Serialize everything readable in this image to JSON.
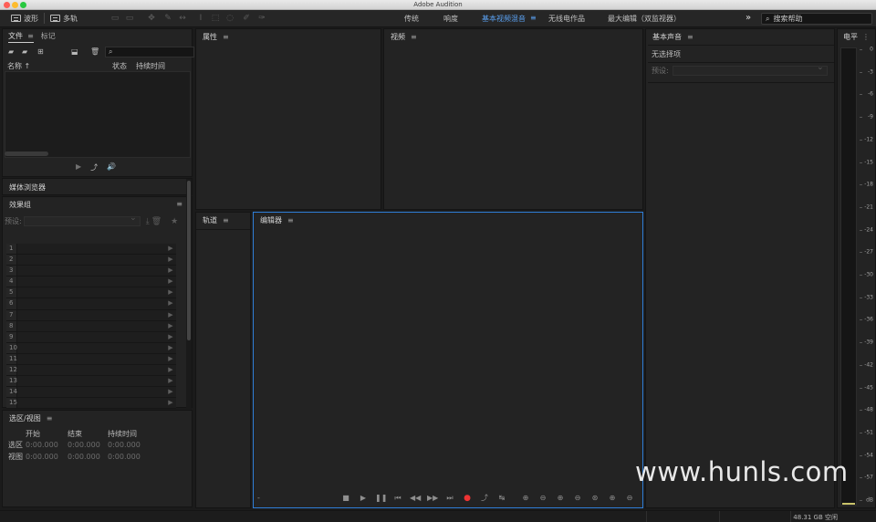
{
  "window": {
    "title": "Adobe Audition"
  },
  "toolbar": {
    "modes": [
      {
        "label": "波形",
        "icon": "waveform-icon"
      },
      {
        "label": "多轨",
        "icon": "multitrack-icon"
      }
    ],
    "workspaces": [
      {
        "label": "传统",
        "active": false
      },
      {
        "label": "响度",
        "active": false
      },
      {
        "label": "基本视频混音",
        "active": true
      },
      {
        "label": "无线电作品",
        "active": false
      },
      {
        "label": "最大编辑（双监视器）",
        "active": false
      }
    ],
    "workspace_menu": "≡",
    "more_label": "»",
    "search_help_placeholder": "搜索帮助"
  },
  "files_panel": {
    "tabs": [
      {
        "label": "文件",
        "active": true
      },
      {
        "label": "标记",
        "active": false
      }
    ],
    "menu": "≡",
    "search_icon_glyph": "⌕",
    "columns": {
      "name": "名称 ↑",
      "status": "状态",
      "duration": "持续时间"
    }
  },
  "media_browser": {
    "title": "媒体浏览器"
  },
  "effects_rack": {
    "title": "效果组",
    "menu": "≡",
    "preset_label": "预设:",
    "slots": [
      "1",
      "2",
      "3",
      "4",
      "5",
      "6",
      "7",
      "8",
      "9",
      "10",
      "11",
      "12",
      "13",
      "14",
      "15"
    ]
  },
  "selection_view": {
    "title": "选区/视图",
    "menu": "≡",
    "headers": {
      "start": "开始",
      "end": "结束",
      "duration": "持续时间"
    },
    "rows": [
      {
        "label": "选区",
        "start": "0:00.000",
        "end": "0:00.000",
        "duration": "0:00.000"
      },
      {
        "label": "视图",
        "start": "0:00.000",
        "end": "0:00.000",
        "duration": "0:00.000"
      }
    ]
  },
  "properties_panel": {
    "title": "属性",
    "menu": "≡"
  },
  "video_panel": {
    "title": "视频",
    "menu": "≡"
  },
  "tracks_panel": {
    "title": "轨道",
    "menu": "≡"
  },
  "editor_panel": {
    "title": "编辑器",
    "menu": "≡",
    "time_placeholder": "-"
  },
  "essential_sound": {
    "title": "基本声音",
    "menu": "≡",
    "no_selection": "无选择项",
    "preset_label": "预设:"
  },
  "level_meter": {
    "title": "电平",
    "menu": "⋮",
    "ticks": [
      "0",
      "-3",
      "-6",
      "-9",
      "-12",
      "-15",
      "-18",
      "-21",
      "-24",
      "-27",
      "-30",
      "-33",
      "-36",
      "-39",
      "-42",
      "-45",
      "-48",
      "-51",
      "-54",
      "-57",
      "dB"
    ],
    "level_fraction": 0.004
  },
  "watermark": "www.hunls.com",
  "status": {
    "disk_free": "48.31 GB 空闲"
  },
  "colors": {
    "accent": "#2f7ed8",
    "workspace_active": "#5aa0f0",
    "record": "#e33333",
    "meter": "#c9c36a"
  }
}
